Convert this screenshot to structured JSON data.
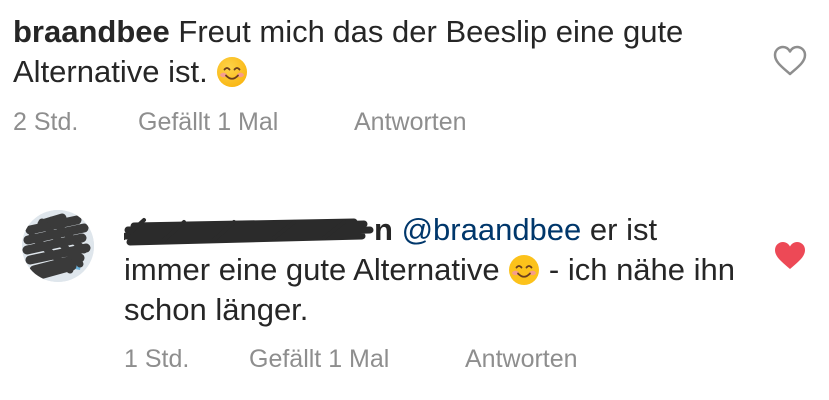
{
  "comments": [
    {
      "username": "braandbee",
      "text": "Freut mich das der Beeslip eine gute Alternative ist.",
      "emoji": "smiling-face-emoji",
      "time": "2 Std.",
      "likes": "Gefällt 1 Mal",
      "reply_label": "Antworten",
      "liked": false
    },
    {
      "username_visible_suffix": "n",
      "mention": "@braandbee",
      "text_before_emoji": "er ist immer eine gute Alternative",
      "emoji": "smiling-face-emoji",
      "text_after_emoji": "- ich nähe ihn schon länger.",
      "time": "1 Std.",
      "likes": "Gefällt 1 Mal",
      "reply_label": "Antworten",
      "liked": true
    }
  ],
  "colors": {
    "text": "#262626",
    "meta": "#8e8e8e",
    "mention": "#00376b",
    "heart_liked": "#ed4956",
    "heart_outline": "#8e8e8e"
  }
}
